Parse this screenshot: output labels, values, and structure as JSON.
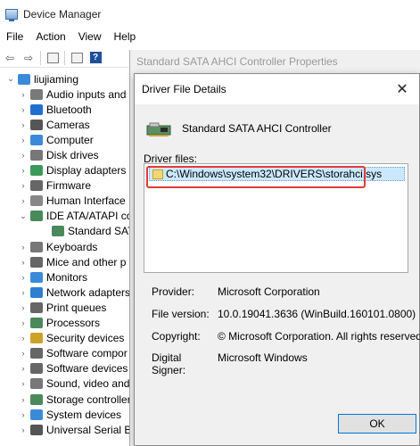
{
  "device_manager": {
    "title": "Device Manager",
    "menu": [
      "File",
      "Action",
      "View",
      "Help"
    ],
    "tree": {
      "root": "liujiaming",
      "categories": [
        {
          "label": "Audio inputs and",
          "icon": "speaker-icon",
          "color": "#7a7a7a"
        },
        {
          "label": "Bluetooth",
          "icon": "bluetooth-icon",
          "color": "#1f6fd1"
        },
        {
          "label": "Cameras",
          "icon": "camera-icon",
          "color": "#555555"
        },
        {
          "label": "Computer",
          "icon": "computer-icon",
          "color": "#3b8ad9"
        },
        {
          "label": "Disk drives",
          "icon": "disk-drive-icon",
          "color": "#777777"
        },
        {
          "label": "Display adapters",
          "icon": "display-adapter-icon",
          "color": "#3a9a5b"
        },
        {
          "label": "Firmware",
          "icon": "firmware-icon",
          "color": "#666666"
        },
        {
          "label": "Human Interface",
          "icon": "hid-icon",
          "color": "#888888"
        },
        {
          "label": "IDE ATA/ATAPI co",
          "icon": "ide-controller-icon",
          "color": "#4a8a5a",
          "expanded": true,
          "children": [
            "Standard SATA"
          ]
        },
        {
          "label": "Keyboards",
          "icon": "keyboard-icon",
          "color": "#777777"
        },
        {
          "label": "Mice and other p",
          "icon": "mouse-icon",
          "color": "#666666"
        },
        {
          "label": "Monitors",
          "icon": "monitor-icon",
          "color": "#3b8ad9"
        },
        {
          "label": "Network adapters",
          "icon": "network-adapter-icon",
          "color": "#2f7fd0"
        },
        {
          "label": "Print queues",
          "icon": "printer-icon",
          "color": "#666666"
        },
        {
          "label": "Processors",
          "icon": "processor-icon",
          "color": "#4a8a5a"
        },
        {
          "label": "Security devices",
          "icon": "security-device-icon",
          "color": "#c9a227"
        },
        {
          "label": "Software compor",
          "icon": "software-component-icon",
          "color": "#666666"
        },
        {
          "label": "Software devices",
          "icon": "software-device-icon",
          "color": "#666666"
        },
        {
          "label": "Sound, video and",
          "icon": "sound-icon",
          "color": "#777777"
        },
        {
          "label": "Storage controller",
          "icon": "storage-controller-icon",
          "color": "#4a8a5a"
        },
        {
          "label": "System devices",
          "icon": "system-device-icon",
          "color": "#3b8ad9"
        },
        {
          "label": "Universal Serial Bu",
          "icon": "usb-icon",
          "color": "#555555"
        }
      ]
    }
  },
  "properties_window": {
    "title": "Standard SATA AHCI Controller Properties"
  },
  "dialog": {
    "title": "Driver File Details",
    "device_name": "Standard SATA AHCI Controller",
    "files_label": "Driver files:",
    "files": [
      "C:\\Windows\\system32\\DRIVERS\\storahci.sys"
    ],
    "info": [
      {
        "key": "Provider:",
        "value": "Microsoft Corporation"
      },
      {
        "key": "File version:",
        "value": "10.0.19041.3636 (WinBuild.160101.0800)"
      },
      {
        "key": "Copyright:",
        "value": "© Microsoft Corporation. All rights reserved."
      },
      {
        "key": "Digital Signer:",
        "value": "Microsoft Windows"
      }
    ],
    "ok_label": "OK",
    "close_label": "✕",
    "highlight_color": "#e03a3a"
  }
}
